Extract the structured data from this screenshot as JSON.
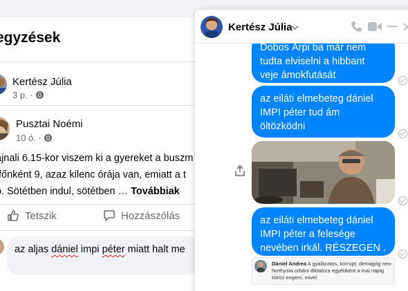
{
  "feed": {
    "title": "egyzések",
    "post1": {
      "author": "Kertész Júlia",
      "time": "3 p. ·"
    },
    "post2": {
      "author": "Pusztai Noémi",
      "time": "10 ó. ·"
    },
    "post_lines": [
      "ajnali 6.15-kor viszem ki a gyereket a buszm",
      "tfőnként 9, azaz kilenc órája van, emiatt a t",
      "ó. Sötétben indul, sötétben …"
    ],
    "more_label": "Továbbiak",
    "like_label": "Tetszik",
    "comment_label": "Hozzászólás",
    "comment": {
      "prefix": "az aljas ",
      "misspelled_1": "dániel",
      "middle": " impi ",
      "misspelled_2": "péter",
      "suffix": "  miatt halt me"
    }
  },
  "chat": {
    "contact_name": "Kertész Júlia",
    "messages": [
      {
        "lines": [
          "Dobos Árpi ba már nem",
          "tudta elviselni a hibbant",
          "veje ámokfutását"
        ]
      },
      {
        "lines": [
          "az eiláti elmebeteg dániel",
          "IMPI péter tud ám",
          "öltözködni"
        ]
      },
      {
        "lines": [
          "az eiláti elmebeteg dániel",
          "IMPI péter a felesége",
          "nevében irkál. RÉSZEGEN ."
        ]
      }
    ],
    "shared_comment": {
      "author": "Dániel Andrea",
      "text": "A gyalázatos, korrupt, demagóg neo-horthysta orbáni diktatúra egyébként a mai napig köröz engem, mivel"
    }
  },
  "colors": {
    "accent": "#0084ff",
    "background": "#f0f2f5",
    "text_secondary": "#65676b"
  }
}
